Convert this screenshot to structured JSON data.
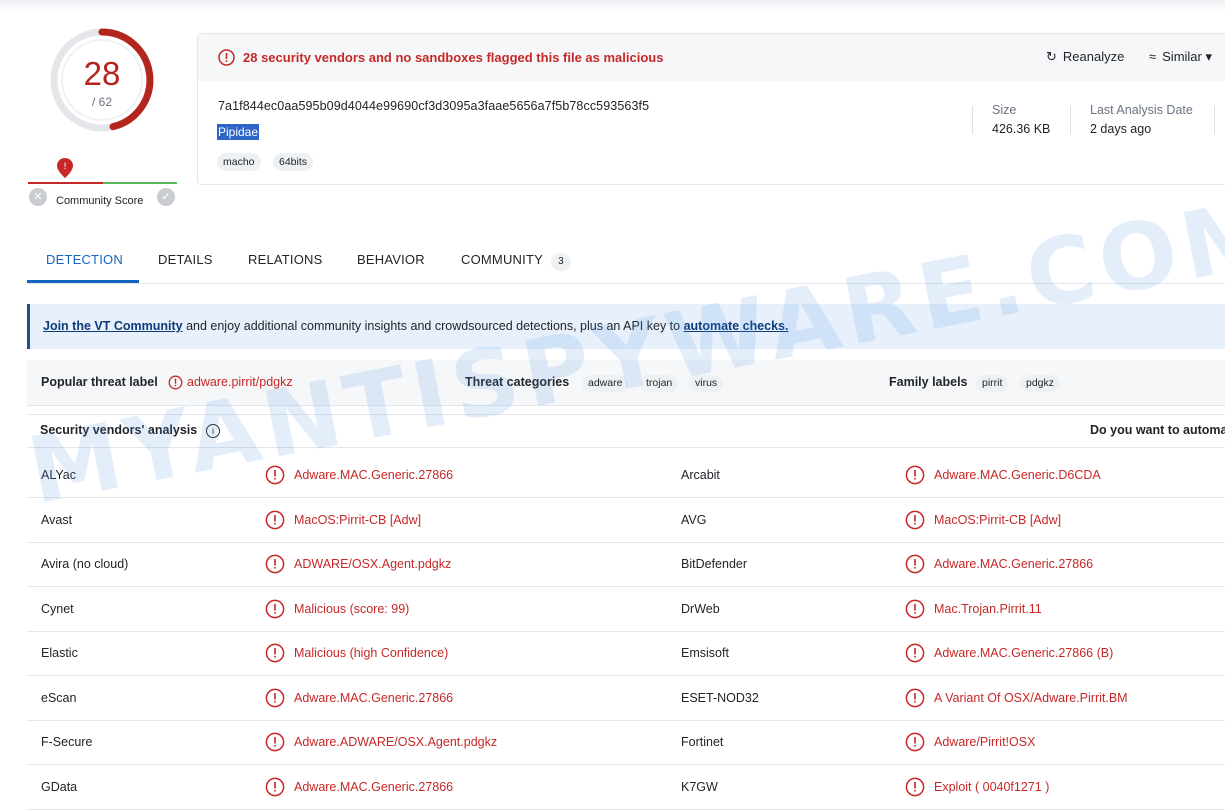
{
  "score": {
    "detected": "28",
    "total": "/ 62",
    "community_label": "Community Score"
  },
  "header": {
    "alert": "28 security vendors and no sandboxes flagged this file as malicious",
    "reanalyze": "Reanalyze",
    "similar": "Similar",
    "hash": "7a1f844ec0aa595b09d4044e99690cf3d3095a3faae5656a7f5b78cc593563f5",
    "filename": "Pipidae",
    "tags": [
      "macho",
      "64bits"
    ],
    "size_label": "Size",
    "size_value": "426.36 KB",
    "last_analysis_label": "Last Analysis Date",
    "last_analysis_value": "2 days ago"
  },
  "tabs": [
    {
      "label": "DETECTION",
      "active": true
    },
    {
      "label": "DETAILS"
    },
    {
      "label": "RELATIONS"
    },
    {
      "label": "BEHAVIOR"
    },
    {
      "label": "COMMUNITY",
      "badge": "3"
    }
  ],
  "banner": {
    "link1": "Join the VT Community",
    "middle": " and enjoy additional community insights and crowdsourced detections, plus an API key to ",
    "link2": "automate checks."
  },
  "threat": {
    "popular_label": "Popular threat label",
    "popular_value": "adware.pirrit/pdgkz",
    "categories_label": "Threat categories",
    "categories": [
      "adware",
      "trojan",
      "virus"
    ],
    "family_label": "Family labels",
    "families": [
      "pirrit",
      "pdgkz"
    ]
  },
  "vendors": {
    "title": "Security vendors' analysis",
    "right_text": "Do you want to automa",
    "rows": [
      {
        "left_name": "ALYac",
        "left_result": "Adware.MAC.Generic.27866",
        "right_name": "Arcabit",
        "right_result": "Adware.MAC.Generic.D6CDA"
      },
      {
        "left_name": "Avast",
        "left_result": "MacOS:Pirrit-CB [Adw]",
        "right_name": "AVG",
        "right_result": "MacOS:Pirrit-CB [Adw]"
      },
      {
        "left_name": "Avira (no cloud)",
        "left_result": "ADWARE/OSX.Agent.pdgkz",
        "right_name": "BitDefender",
        "right_result": "Adware.MAC.Generic.27866"
      },
      {
        "left_name": "Cynet",
        "left_result": "Malicious (score: 99)",
        "right_name": "DrWeb",
        "right_result": "Mac.Trojan.Pirrit.11"
      },
      {
        "left_name": "Elastic",
        "left_result": "Malicious (high Confidence)",
        "right_name": "Emsisoft",
        "right_result": "Adware.MAC.Generic.27866 (B)"
      },
      {
        "left_name": "eScan",
        "left_result": "Adware.MAC.Generic.27866",
        "right_name": "ESET-NOD32",
        "right_result": "A Variant Of OSX/Adware.Pirrit.BM"
      },
      {
        "left_name": "F-Secure",
        "left_result": "Adware.ADWARE/OSX.Agent.pdgkz",
        "right_name": "Fortinet",
        "right_result": "Adware/Pirrit!OSX"
      },
      {
        "left_name": "GData",
        "left_result": "Adware.MAC.Generic.27866",
        "right_name": "K7GW",
        "right_result": "Exploit ( 0040f1271 )"
      }
    ]
  },
  "watermark": "MYANTISPYWARE.COM",
  "colors": {
    "danger": "#c62828",
    "accent": "#1565c0",
    "clean": "#5cb85c"
  }
}
